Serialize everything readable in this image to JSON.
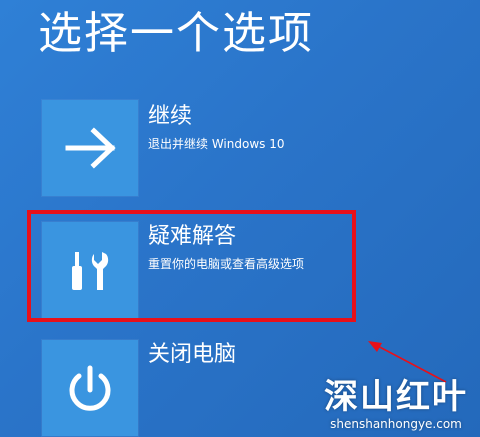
{
  "screen": {
    "title": "选择一个选项"
  },
  "options": [
    {
      "title": "继续",
      "description": "退出并继续 Windows 10",
      "icon": "arrow-right-icon"
    },
    {
      "title": "疑难解答",
      "description": "重置你的电脑或查看高级选项",
      "icon": "tools-icon"
    },
    {
      "title": "关闭电脑",
      "icon": "power-icon"
    }
  ],
  "annotation": {
    "highlight_color": "#e8101a"
  },
  "watermark": {
    "main": "深山红叶",
    "sub": "shenshanhongye.com"
  },
  "colors": {
    "background": "#2a74c9",
    "tile": "#3a95e0",
    "text": "#ffffff"
  }
}
